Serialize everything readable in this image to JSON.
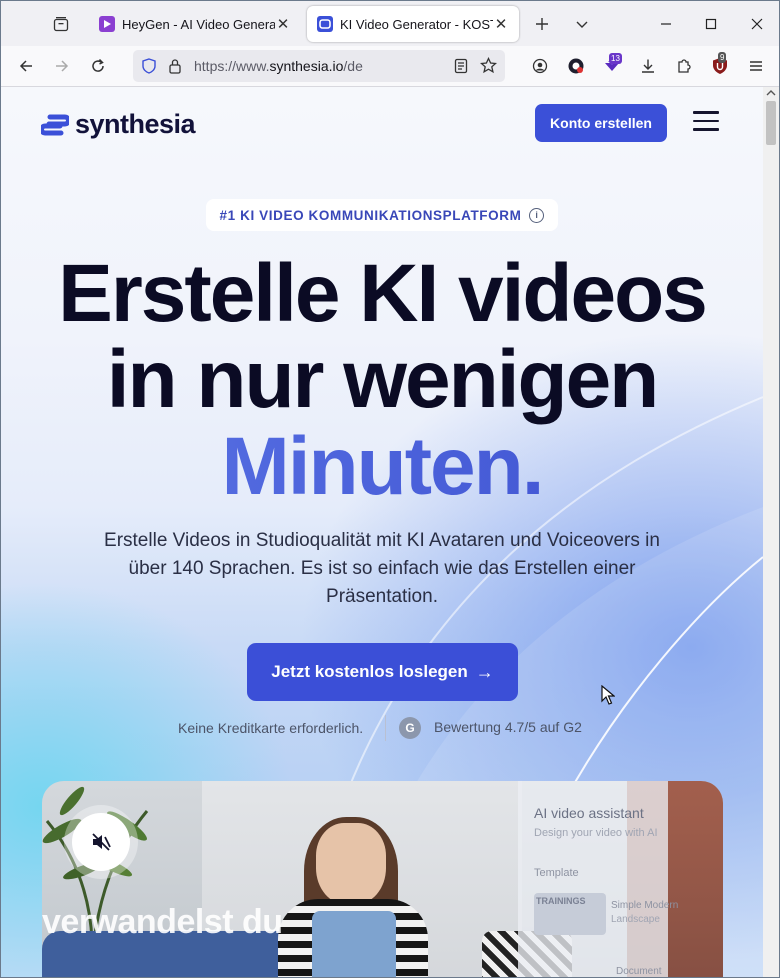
{
  "browser": {
    "tabs": [
      {
        "title": "HeyGen - AI Video Generator",
        "favicon": "heygen-play-icon",
        "color": "#8b3fd1"
      },
      {
        "title": "KI Video Generator - KOSTENLOS",
        "favicon": "synthesia-icon",
        "color": "#3b50d8",
        "active": true
      }
    ],
    "url_prefix": "https://www.",
    "url_domain": "synthesia.io",
    "url_path": "/de",
    "extension_badge_a": "13",
    "extension_badge_b": "9"
  },
  "site": {
    "logo_text": "synthesia",
    "cta_top": "Konto erstellen",
    "eyebrow": "#1 KI VIDEO KOMMUNIKATIONSPLATFORM",
    "headline_line1": "Erstelle KI videos",
    "headline_line2": "in nur wenigen",
    "headline_line3": "Minuten.",
    "subtitle": "Erstelle Videos in Studioqualität mit KI Avataren und Voiceovers in über 140 Sprachen. Es ist so einfach wie das Erstellen einer Präsentation.",
    "cta_main": "Jetzt kostenlos loslegen",
    "cta_arrow": "→",
    "trust_note": "Keine Kreditkarte erforderlich.",
    "g2_mark": "G",
    "rating": "Bewertung 4.7/5 auf G2",
    "accent_color": "#3b50d8"
  },
  "video": {
    "overlay_text": "verwandelst du",
    "panel_title": "AI video assistant",
    "panel_subtitle": "Design your video with AI",
    "template_label": "Template",
    "thumb_label": "TRAININGS",
    "template_name": "Simple Modern",
    "template_format": "Landscape",
    "doc_label": "Document"
  }
}
